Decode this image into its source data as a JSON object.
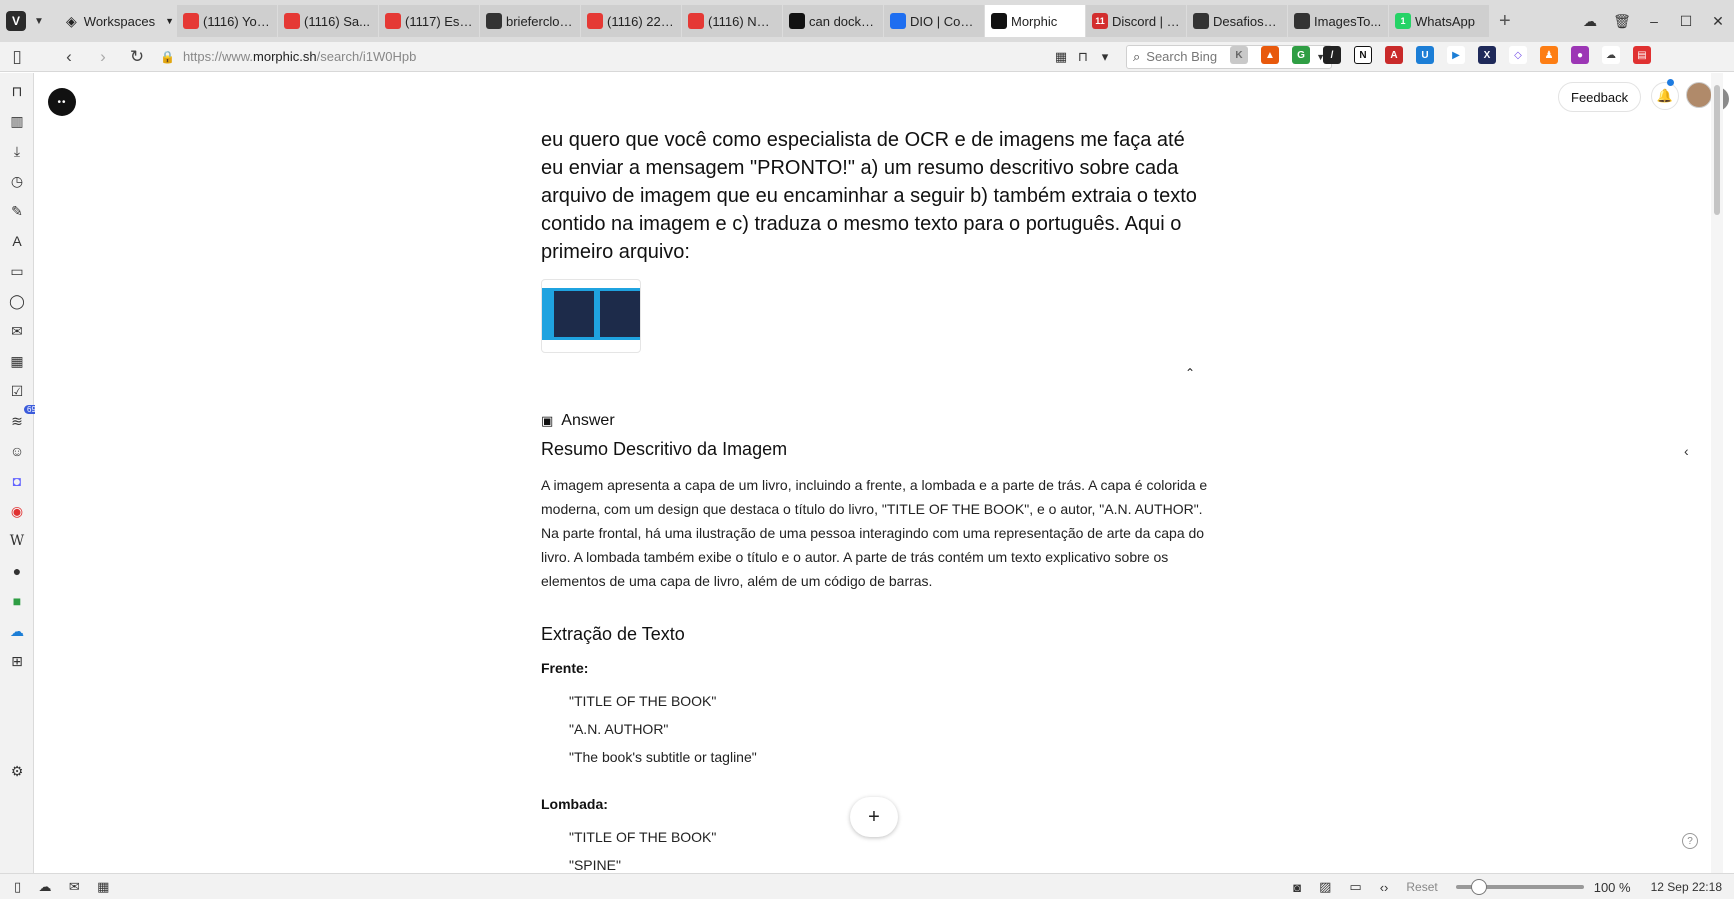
{
  "browser": {
    "workspaces_label": "Workspaces",
    "tabs": [
      {
        "label": "(1116) You...",
        "icon": "youtube-icon",
        "color": "#e53935",
        "badge": ""
      },
      {
        "label": "(1116) Sa...",
        "icon": "youtube-icon",
        "color": "#e53935",
        "badge": ""
      },
      {
        "label": "(1117) Ess...",
        "icon": "youtube-icon",
        "color": "#e53935",
        "badge": ""
      },
      {
        "label": "brieferclou...",
        "icon": "github-icon",
        "color": "#333333",
        "badge": ""
      },
      {
        "label": "(1116) 22 ...",
        "icon": "youtube-icon",
        "color": "#e53935",
        "badge": ""
      },
      {
        "label": "(1116) Net...",
        "icon": "youtube-icon",
        "color": "#e53935",
        "badge": ""
      },
      {
        "label": "can docker...",
        "icon": "chatgpt-icon",
        "color": "#111111",
        "badge": ""
      },
      {
        "label": "DIO | Codi...",
        "icon": "dio-icon",
        "color": "#1e6ef0",
        "badge": ""
      },
      {
        "label": "Morphic",
        "icon": "morphic-icon",
        "color": "#111111",
        "badge": "",
        "active": true
      },
      {
        "label": "Discord | #...",
        "icon": "discord-icon",
        "color": "#d32f2f",
        "badge": "11"
      },
      {
        "label": "Desafios_...",
        "icon": "github-icon",
        "color": "#333333",
        "badge": ""
      },
      {
        "label": "ImagesTo...",
        "icon": "github-icon",
        "color": "#333333",
        "badge": ""
      },
      {
        "label": "WhatsApp",
        "icon": "whatsapp-icon",
        "color": "#25d366",
        "badge": "1"
      }
    ],
    "url": {
      "prefix": "https://www.",
      "host": "morphic.sh",
      "path": "/search/i1W0Hpb"
    },
    "search_placeholder": "Search Bing"
  },
  "sidepanel": {
    "feeds_badge": "69"
  },
  "page": {
    "feedback_label": "Feedback",
    "question": "eu quero que você como especialista de OCR e de imagens me faça até eu enviar a mensagem \"PRONTO!\" a) um resumo descritivo sobre cada arquivo de imagem que eu encaminhar a seguir b) também extraia o texto contido na imagem e c) traduza o mesmo texto para o português. Aqui o primeiro arquivo:",
    "answer_label": "Answer",
    "summary_heading": "Resumo Descritivo da Imagem",
    "summary_text": "A imagem apresenta a capa de um livro, incluindo a frente, a lombada e a parte de trás. A capa é colorida e moderna, com um design que destaca o título do livro, \"TITLE OF THE BOOK\", e o autor, \"A.N. AUTHOR\". Na parte frontal, há uma ilustração de uma pessoa interagindo com uma representação de arte da capa do livro. A lombada também exibe o título e o autor. A parte de trás contém um texto explicativo sobre os elementos de uma capa de livro, além de um código de barras.",
    "extraction_heading": "Extração de Texto",
    "front_label": "Frente:",
    "front_items": [
      "\"TITLE OF THE BOOK\"",
      "\"A.N. AUTHOR\"",
      "\"The book's subtitle or tagline\""
    ],
    "spine_label": "Lombada:",
    "spine_items": [
      "\"TITLE OF THE BOOK\"",
      "\"SPINE\""
    ]
  },
  "statusbar": {
    "reset_label": "Reset",
    "zoom": "100 %",
    "datetime": "12 Sep 22:18"
  }
}
